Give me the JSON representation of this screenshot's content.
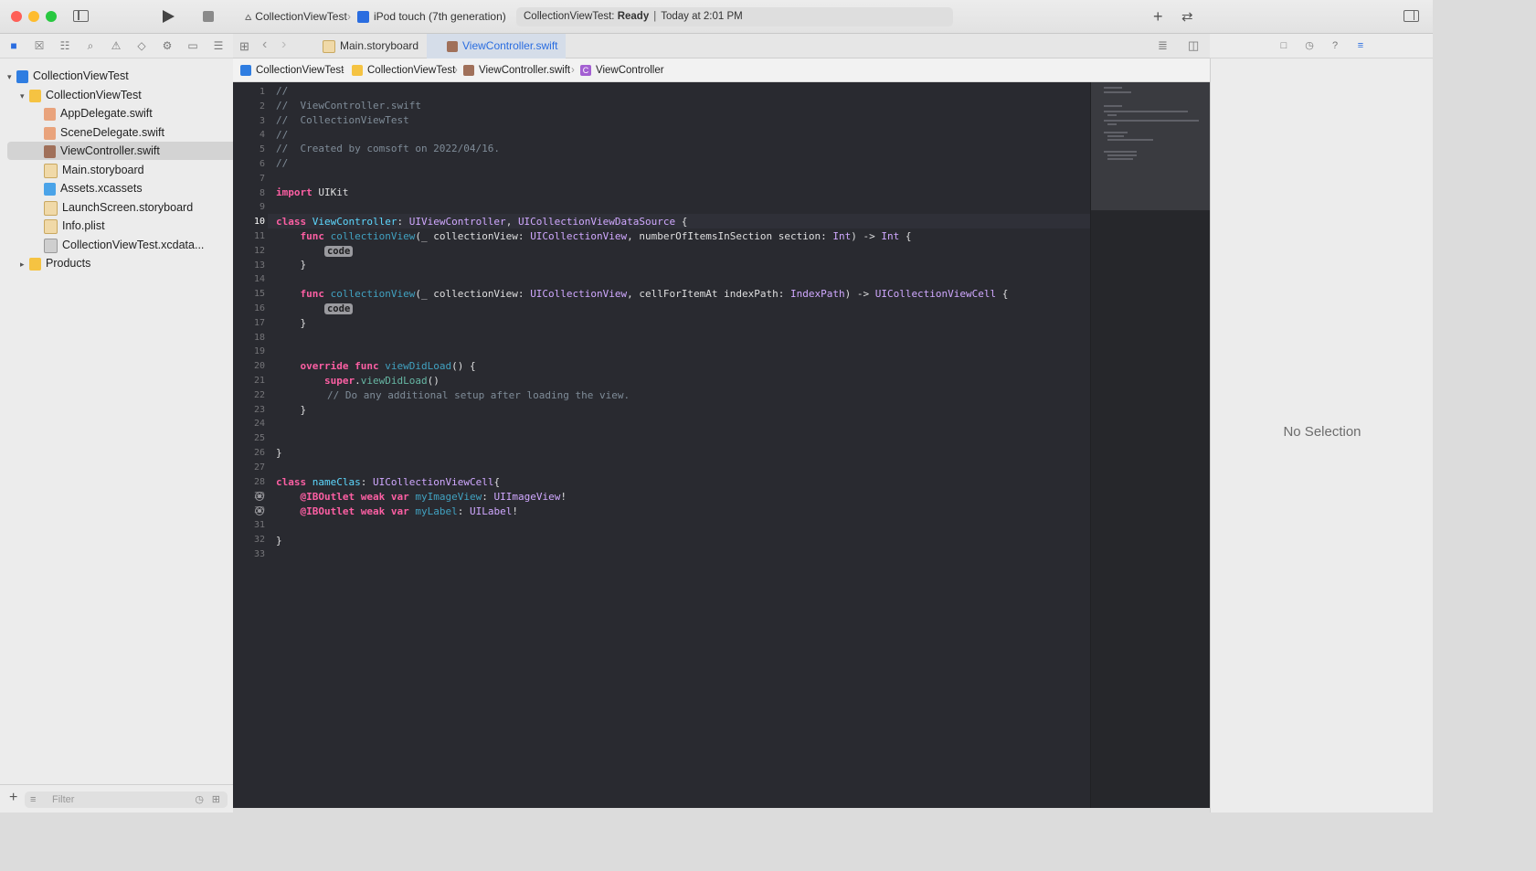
{
  "toolbar": {
    "project_scheme": "CollectionViewTest",
    "device": "iPod touch (7th generation)",
    "status_prefix": "CollectionViewTest: ",
    "status_state": "Ready",
    "status_time": "Today at 2:01 PM"
  },
  "navigator": {
    "items": [
      {
        "label": "CollectionViewTest",
        "kind": "project"
      },
      {
        "label": "CollectionViewTest",
        "kind": "folder"
      },
      {
        "label": "AppDelegate.swift",
        "kind": "swift"
      },
      {
        "label": "SceneDelegate.swift",
        "kind": "swift"
      },
      {
        "label": "ViewController.swift",
        "kind": "swift",
        "selected": true
      },
      {
        "label": "Main.storyboard",
        "kind": "storyboard"
      },
      {
        "label": "Assets.xcassets",
        "kind": "assets"
      },
      {
        "label": "LaunchScreen.storyboard",
        "kind": "storyboard"
      },
      {
        "label": "Info.plist",
        "kind": "plist"
      },
      {
        "label": "CollectionViewTest.xcdata...",
        "kind": "data"
      },
      {
        "label": "Products",
        "kind": "folder"
      }
    ],
    "filter_placeholder": "Filter"
  },
  "tabs": [
    {
      "label": "Main.storyboard",
      "active": false
    },
    {
      "label": "ViewController.swift",
      "active": true
    }
  ],
  "breadcrumb": [
    "CollectionViewTest",
    "CollectionViewTest",
    "ViewController.swift",
    "ViewController"
  ],
  "editor": {
    "current_line": 10,
    "line_count": 33,
    "placeholder": "code",
    "comments": {
      "l1": "//",
      "l2": "//  ViewController.swift",
      "l3": "//  CollectionViewTest",
      "l4": "//",
      "l5": "//  Created by comsoft on 2022/04/16.",
      "l6": "//",
      "l22": "// Do any additional setup after loading the view."
    }
  },
  "inspector": {
    "empty_text": "No Selection"
  },
  "colors": {
    "editor_bg": "#292a30",
    "keyword": "#fc5fa3",
    "accent": "#2a6de0"
  }
}
